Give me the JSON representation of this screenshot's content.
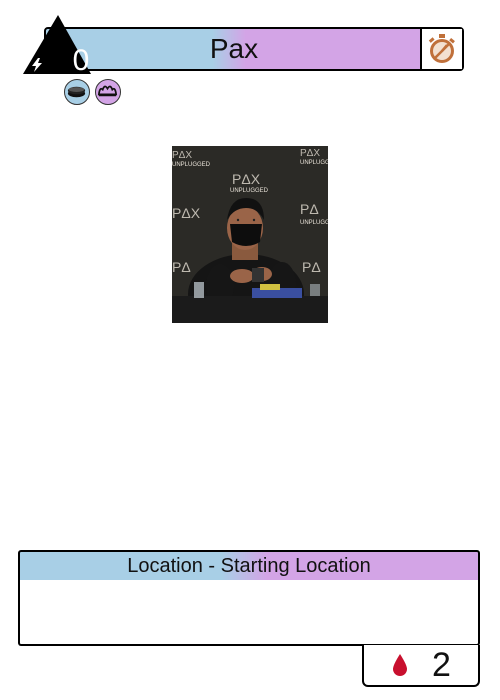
{
  "card": {
    "cost": "0",
    "name": "Pax",
    "type_line": "Location - Starting Location",
    "text": "",
    "health": "2"
  },
  "icons": {
    "timer": "stopwatch-icon",
    "lightning": "lightning-icon",
    "gem_1": "blue-disc-gem-icon",
    "gem_2": "purple-crown-gem-icon",
    "health": "blood-drop-icon"
  },
  "colors": {
    "blue": "#a8cfe6",
    "purple": "#d3a4e6",
    "timer_icon": "#c0703a",
    "blood": "#c8102e"
  },
  "art": {
    "sign_text": "PAX UNPLUGGED"
  }
}
